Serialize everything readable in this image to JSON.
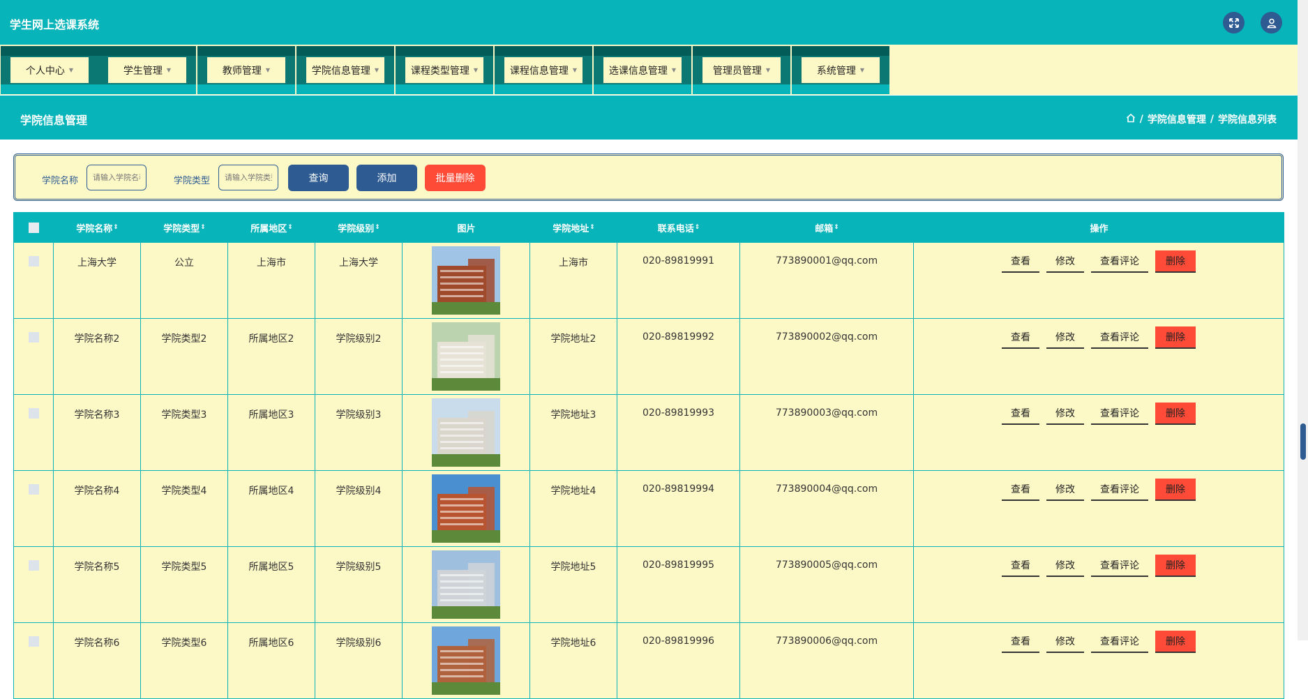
{
  "app": {
    "title": "学生网上选课系统"
  },
  "nav": [
    {
      "label": "个人中心"
    },
    {
      "label": "学生管理"
    },
    {
      "label": "教师管理"
    },
    {
      "label": "学院信息管理"
    },
    {
      "label": "课程类型管理"
    },
    {
      "label": "课程信息管理"
    },
    {
      "label": "选课信息管理"
    },
    {
      "label": "管理员管理"
    },
    {
      "label": "系统管理"
    }
  ],
  "page": {
    "title": "学院信息管理",
    "breadcrumb": [
      "学院信息管理",
      "学院信息列表"
    ]
  },
  "search": {
    "name_label": "学院名称",
    "name_placeholder": "请输入学院名称",
    "type_label": "学院类型",
    "type_placeholder": "请输入学院类型",
    "query_btn": "查询",
    "add_btn": "添加",
    "batch_delete_btn": "批量删除"
  },
  "table": {
    "headers": [
      "学院名称",
      "学院类型",
      "所属地区",
      "学院级别",
      "图片",
      "学院地址",
      "联系电话",
      "邮箱",
      "操作"
    ],
    "rows": [
      {
        "name": "上海大学",
        "type": "公立",
        "region": "上海市",
        "level": "上海大学",
        "address": "上海市",
        "phone": "020-89819991",
        "email": "773890001@qq.com"
      },
      {
        "name": "学院名称2",
        "type": "学院类型2",
        "region": "所属地区2",
        "level": "学院级别2",
        "address": "学院地址2",
        "phone": "020-89819992",
        "email": "773890002@qq.com"
      },
      {
        "name": "学院名称3",
        "type": "学院类型3",
        "region": "所属地区3",
        "level": "学院级别3",
        "address": "学院地址3",
        "phone": "020-89819993",
        "email": "773890003@qq.com"
      },
      {
        "name": "学院名称4",
        "type": "学院类型4",
        "region": "所属地区4",
        "level": "学院级别4",
        "address": "学院地址4",
        "phone": "020-89819994",
        "email": "773890004@qq.com"
      },
      {
        "name": "学院名称5",
        "type": "学院类型5",
        "region": "所属地区5",
        "level": "学院级别5",
        "address": "学院地址5",
        "phone": "020-89819995",
        "email": "773890005@qq.com"
      },
      {
        "name": "学院名称6",
        "type": "学院类型6",
        "region": "所属地区6",
        "level": "学院级别6",
        "address": "学院地址6",
        "phone": "020-89819996",
        "email": "773890006@qq.com"
      }
    ],
    "actions": {
      "view": "查看",
      "edit": "修改",
      "comments": "查看评论",
      "delete": "删除"
    }
  },
  "colors": {
    "teal": "#06b4ba",
    "cream": "#fdf9c7",
    "navy": "#2d5b92",
    "danger": "#fe4b37"
  },
  "icons": [
    "fullscreen-icon",
    "user-icon",
    "home-icon"
  ]
}
